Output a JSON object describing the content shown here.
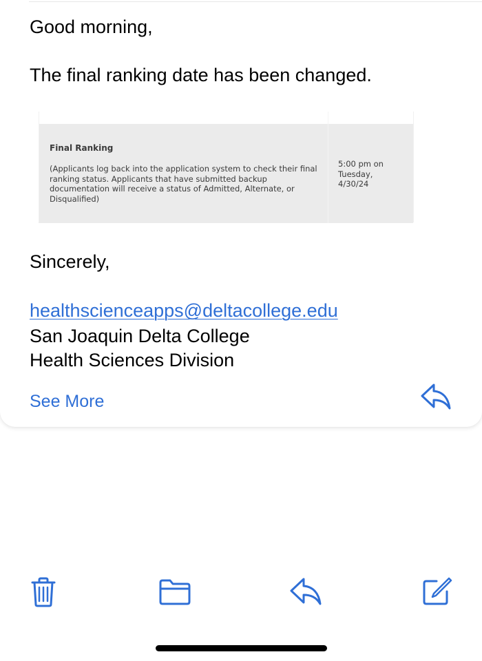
{
  "email": {
    "greeting": "Good morning,",
    "announcement": "The final ranking date has been changed.",
    "schedule": {
      "event_title": "Final Ranking",
      "event_description": "(Applicants log back into the application system to check their final ranking status. Applicants that have submitted backup documentation will receive a status of Admitted, Alternate, or Disqualified)",
      "event_time": "5:00 pm on Tuesday, 4/30/24"
    },
    "signoff": "Sincerely,",
    "signature": {
      "email": "healthscienceapps@deltacollege.edu",
      "college": "San Joaquin Delta College",
      "division": "Health Sciences Division"
    },
    "see_more_label": "See More"
  },
  "toolbar": {
    "icons": [
      "trash-icon",
      "folder-icon",
      "reply-icon",
      "compose-icon"
    ]
  },
  "colors": {
    "accent": "#2f6fd6",
    "table_background": "#ebebeb",
    "text": "#000000"
  }
}
